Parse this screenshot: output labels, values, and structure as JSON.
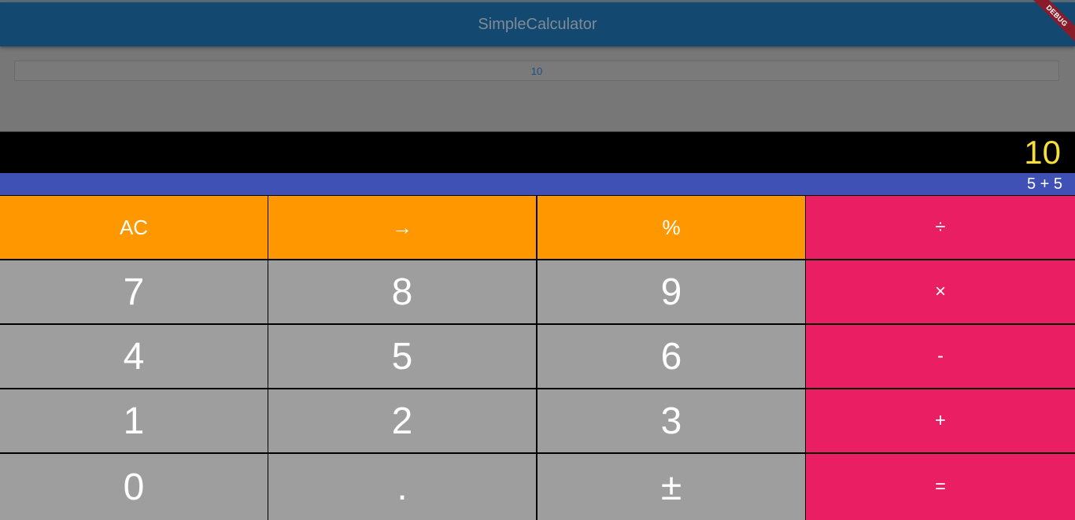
{
  "app": {
    "title": "SimpleCalculator",
    "debug_banner": "DEBUG"
  },
  "history": {
    "value": "10"
  },
  "display": {
    "result": "10",
    "expression": "5 + 5"
  },
  "keys": {
    "ac": "AC",
    "backspace": "→",
    "percent": "%",
    "divide": "÷",
    "seven": "7",
    "eight": "8",
    "nine": "9",
    "multiply": "×",
    "four": "4",
    "five": "5",
    "six": "6",
    "minus": "-",
    "one": "1",
    "two": "2",
    "three": "3",
    "plus": "+",
    "zero": "0",
    "decimal": ".",
    "plus_minus": "±",
    "equals": "="
  },
  "colors": {
    "appbar": "#134870",
    "function_key": "#ff9800",
    "number_key": "#9e9e9e",
    "operator_key": "#e91e63",
    "expression_bar": "#3f51b5",
    "result_text": "#f4df3c"
  }
}
